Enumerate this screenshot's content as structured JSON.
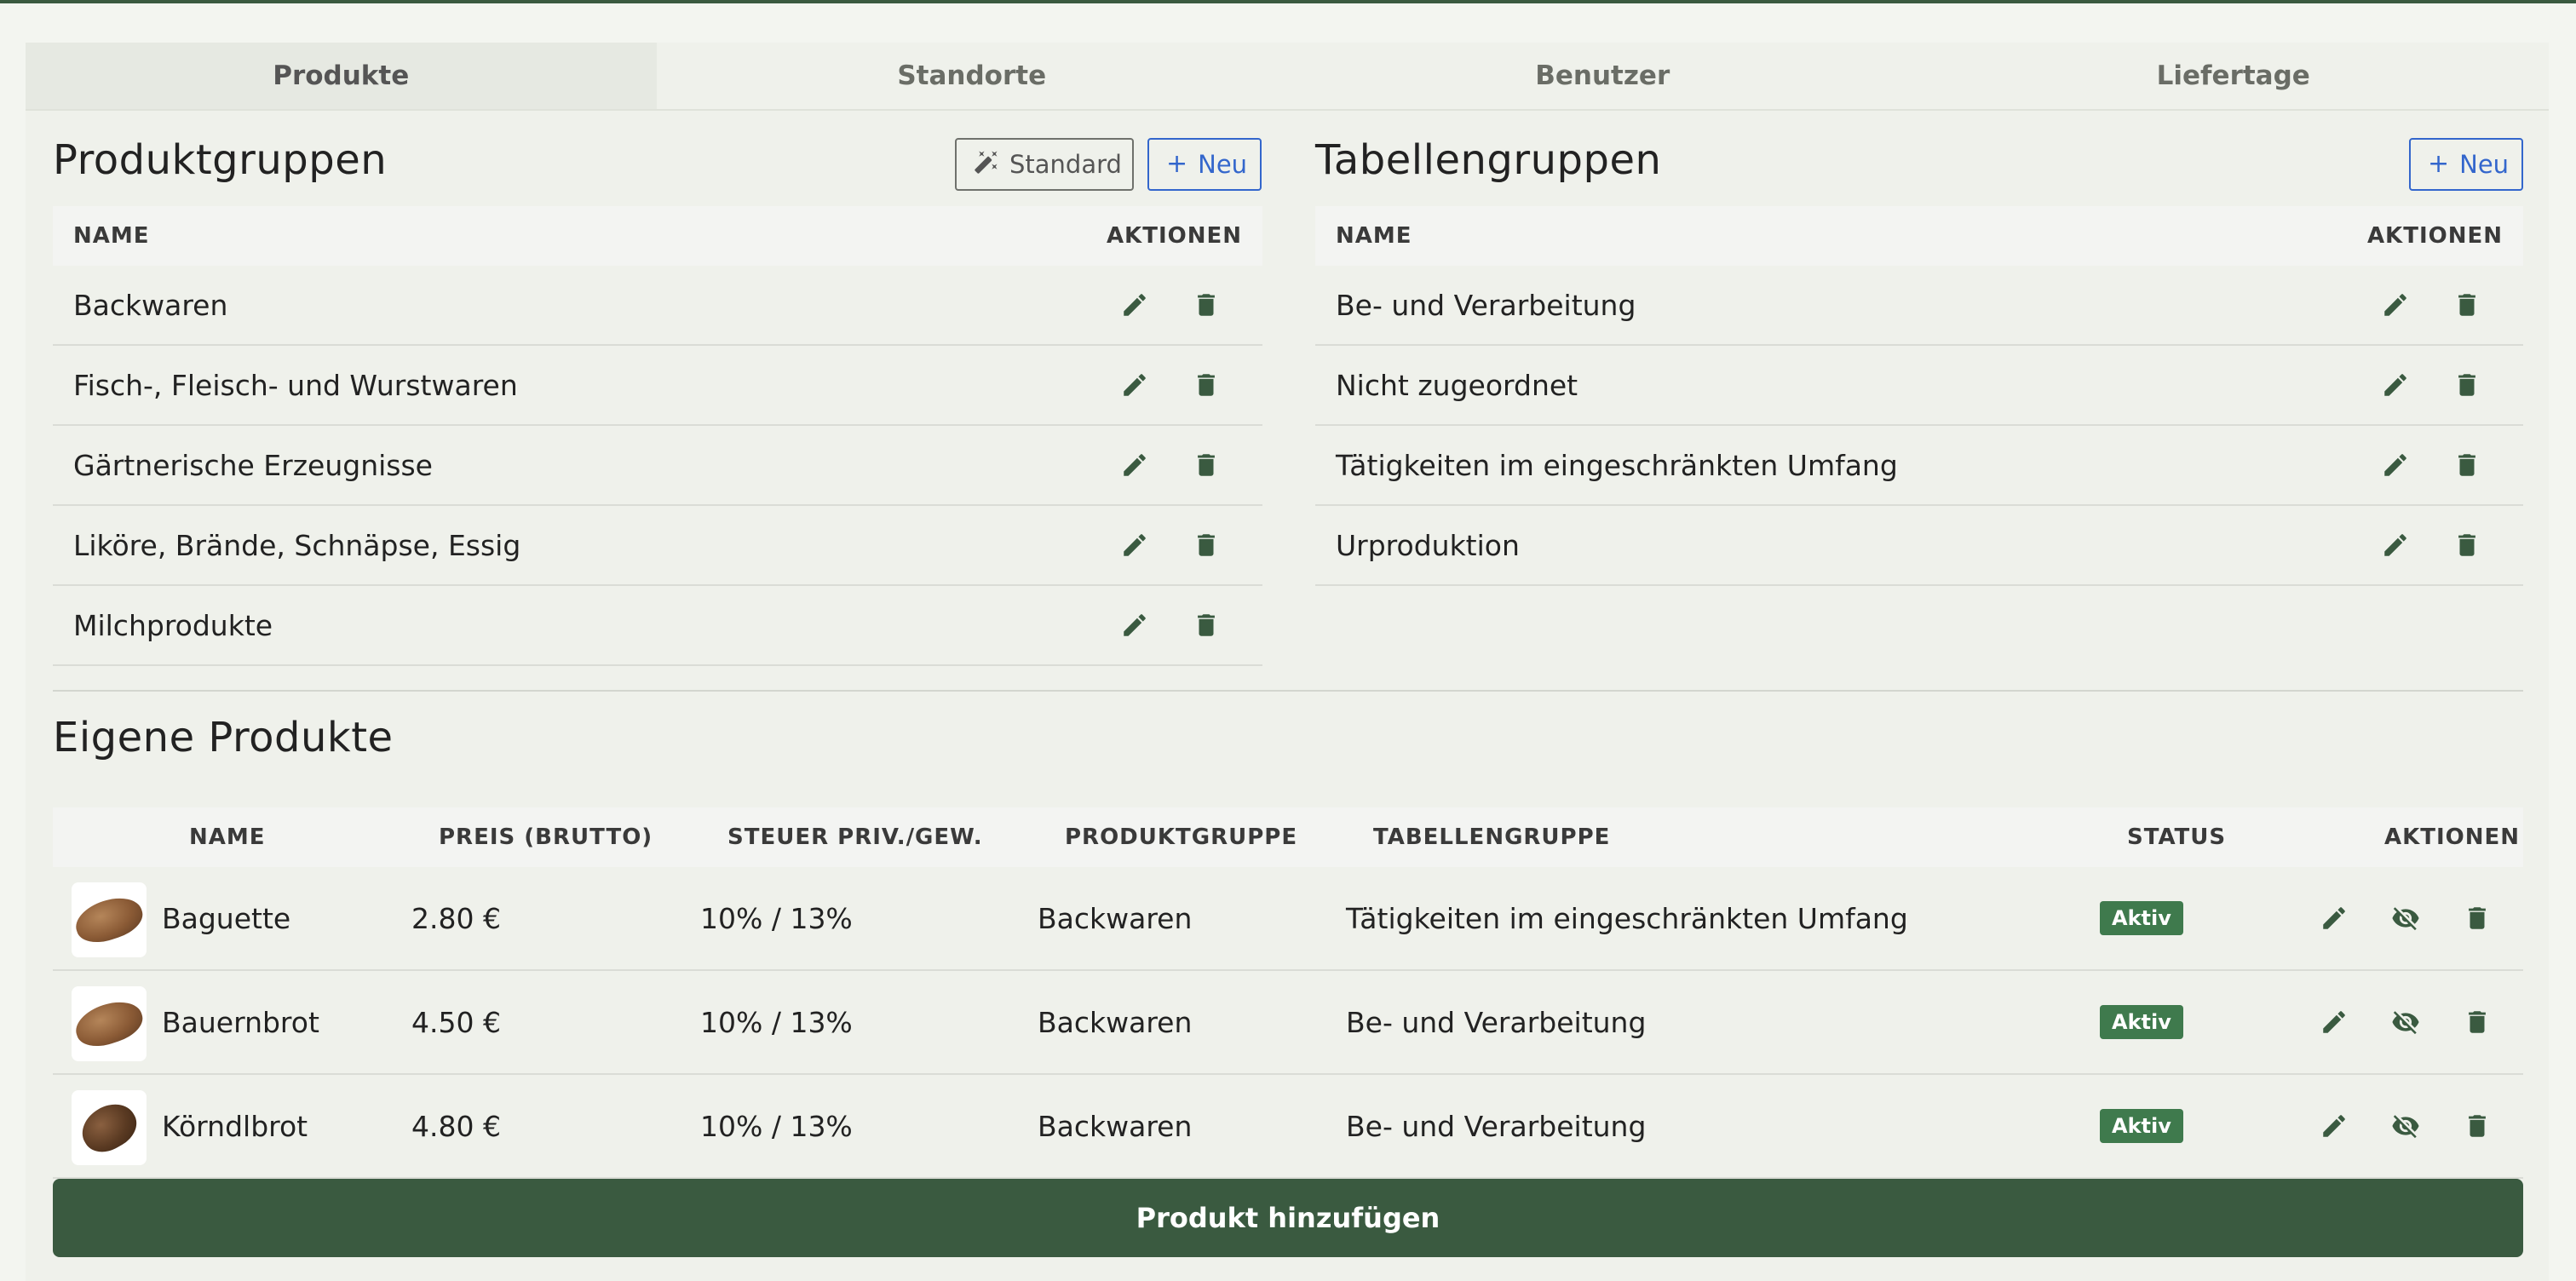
{
  "tabs": [
    {
      "label": "Produkte",
      "active": true
    },
    {
      "label": "Standorte",
      "active": false
    },
    {
      "label": "Benutzer",
      "active": false
    },
    {
      "label": "Liefertage",
      "active": false
    }
  ],
  "produktgruppen": {
    "title": "Produktgruppen",
    "standard_button": "Standard",
    "new_button": "Neu",
    "col_name": "NAME",
    "col_actions": "AKTIONEN",
    "rows": [
      "Backwaren",
      "Fisch-, Fleisch- und Wurstwaren",
      "Gärtnerische Erzeugnisse",
      "Liköre, Brände, Schnäpse, Essig",
      "Milchprodukte"
    ]
  },
  "tabellengruppen": {
    "title": "Tabellengruppen",
    "new_button": "Neu",
    "col_name": "NAME",
    "col_actions": "AKTIONEN",
    "rows": [
      "Be- und Verarbeitung",
      "Nicht zugeordnet",
      "Tätigkeiten im eingeschränkten Umfang",
      "Urproduktion"
    ]
  },
  "eigene_produkte": {
    "title": "Eigene Produkte",
    "columns": {
      "name": "NAME",
      "price": "PREIS (BRUTTO)",
      "tax": "STEUER PRIV./GEW.",
      "group": "PRODUKTGRUPPE",
      "table_group": "TABELLENGRUPPE",
      "status": "STATUS",
      "actions": "AKTIONEN"
    },
    "rows": [
      {
        "name": "Baguette",
        "price": "2.80 €",
        "tax": "10% / 13%",
        "group": "Backwaren",
        "table_group": "Tätigkeiten im eingeschränkten Umfang",
        "status": "Aktiv"
      },
      {
        "name": "Bauernbrot",
        "price": "4.50 €",
        "tax": "10% / 13%",
        "group": "Backwaren",
        "table_group": "Be- und Verarbeitung",
        "status": "Aktiv"
      },
      {
        "name": "Körndlbrot",
        "price": "4.80 €",
        "tax": "10% / 13%",
        "group": "Backwaren",
        "table_group": "Be- und Verarbeitung",
        "status": "Aktiv"
      }
    ],
    "add_button": "Produkt hinzufügen"
  },
  "colors": {
    "brand": "#3a5a40",
    "badge": "#3f7a4d",
    "link": "#3366cc"
  }
}
